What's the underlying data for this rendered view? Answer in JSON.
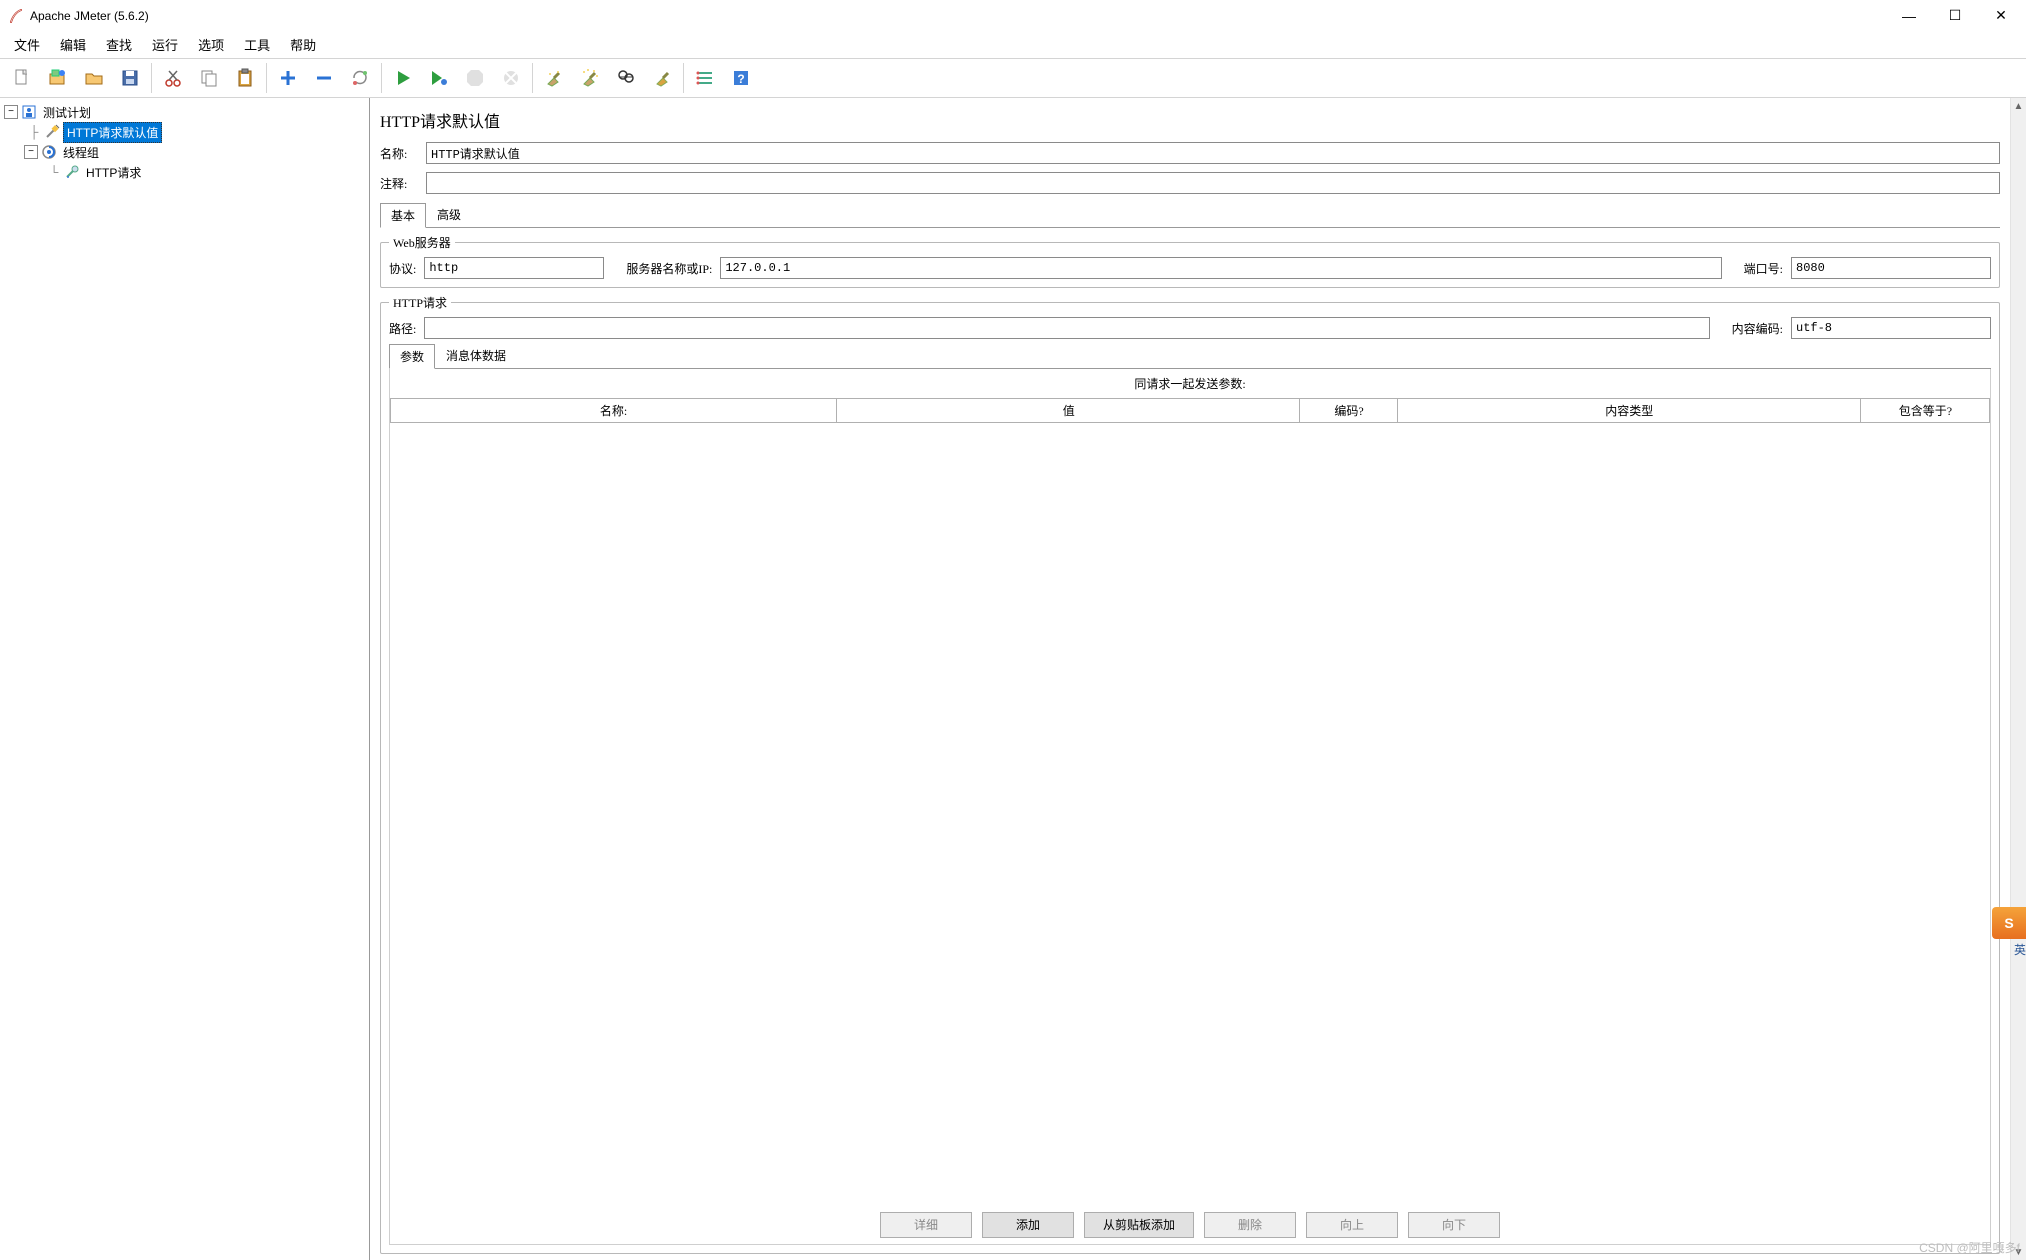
{
  "title": "Apache JMeter (5.6.2)",
  "menu": {
    "file": "文件",
    "edit": "编辑",
    "search": "查找",
    "run": "运行",
    "options": "选项",
    "tools": "工具",
    "help": "帮助"
  },
  "tree": {
    "root": "测试计划",
    "node1": "HTTP请求默认值",
    "node2": "线程组",
    "node3": "HTTP请求"
  },
  "panel": {
    "heading": "HTTP请求默认值",
    "name_label": "名称:",
    "name_value": "HTTP请求默认值",
    "comment_label": "注释:",
    "comment_value": "",
    "tab_basic": "基本",
    "tab_advanced": "高级",
    "ws_legend": "Web服务器",
    "proto_label": "协议:",
    "proto_value": "http",
    "host_label": "服务器名称或IP:",
    "host_value": "127.0.0.1",
    "port_label": "端口号:",
    "port_value": "8080",
    "req_legend": "HTTP请求",
    "path_label": "路径:",
    "path_value": "",
    "enc_label": "内容编码:",
    "enc_value": "utf-8",
    "param_tab": "参数",
    "body_tab": "消息体数据",
    "send_with": "同请求一起发送参数:",
    "th_name": "名称:",
    "th_value": "值",
    "th_encode": "编码?",
    "th_ctype": "内容类型",
    "th_inceq": "包含等于?",
    "btn_detail": "详细",
    "btn_add": "添加",
    "btn_addclip": "从剪贴板添加",
    "btn_del": "删除",
    "btn_up": "向上",
    "btn_down": "向下"
  },
  "watermark": "CSDN @阿里嘎多f",
  "ime": "S",
  "ime_lang": "英"
}
